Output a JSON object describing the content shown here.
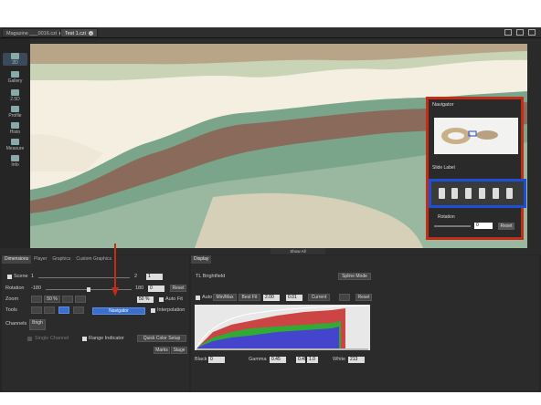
{
  "tabs": [
    {
      "label": "Magazine ___0016.czi"
    },
    {
      "label": "Test 1.czi"
    }
  ],
  "leftbar": [
    {
      "label": "2D"
    },
    {
      "label": "Gallery"
    },
    {
      "label": "2.5D"
    },
    {
      "label": "Profile"
    },
    {
      "label": "Histo"
    },
    {
      "label": "Measure"
    },
    {
      "label": "Info"
    }
  ],
  "navigator": {
    "title": "Navigator",
    "slide_label": "Slide Label",
    "rotation_label": "Rotation",
    "rotation_value": "0",
    "reset": "Reset"
  },
  "show_all": "Show All",
  "panel_tabs": [
    "Dimensions",
    "Player",
    "Graphics",
    "Custom Graphics"
  ],
  "dims": {
    "scene_label": "Scene",
    "scene_min": "1",
    "scene_max": "2",
    "scene_value": "1",
    "rotation_label": "Rotation",
    "rotation_min": "-180",
    "rotation_max": "180",
    "rotation_value": "0",
    "reset": "Reset",
    "zoom_label": "Zoom",
    "zoom_fit": "50 %",
    "zoom_value": "50 %",
    "auto_fit": "Auto Fit",
    "tools_label": "Tools",
    "navigator_btn": "Navigator",
    "interpolation": "Interpolation",
    "channels_label": "Channels",
    "channel_name": "Brigh",
    "single_channel": "Single Channel",
    "range_indicator": "Range Indicator",
    "quick_color": "Quick Color Setup",
    "marks": "Marks",
    "stage": "Stage"
  },
  "display": {
    "tab": "Display",
    "channel": "TL Brightfield",
    "spline": "Spline Mode",
    "auto": "Auto",
    "minmax": "Min/Max",
    "bestfit": "Best Fit",
    "bestfit_val": "2.00",
    "bestfit_val2": "0.01",
    "current": "Current",
    "reset": "Reset",
    "black_label": "Black",
    "black_val": "0",
    "gamma_label": "Gamma",
    "gamma_val": "0.45",
    "gamma_val2": "0.45",
    "gamma_val3": "1.0",
    "white_label": "White",
    "white_val": "213"
  },
  "colors": {
    "red_outline": "#c32d16",
    "blue_outline": "#1d4fd6"
  }
}
